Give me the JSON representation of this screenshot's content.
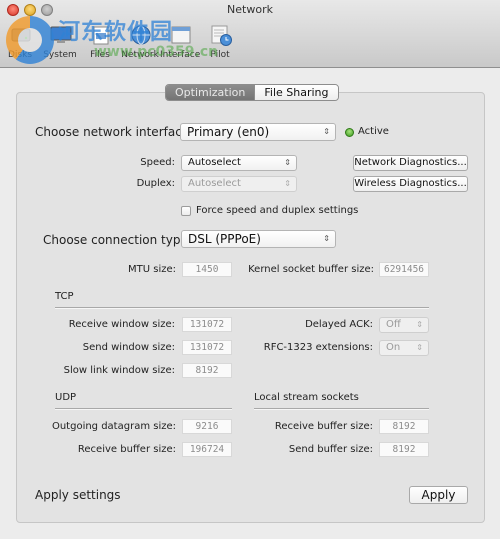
{
  "window": {
    "title": "Network"
  },
  "toolbar": {
    "items": [
      {
        "label": "Disks",
        "icon": "disk-icon"
      },
      {
        "label": "System",
        "icon": "system-icon"
      },
      {
        "label": "Files",
        "icon": "files-icon"
      },
      {
        "label": "Network",
        "icon": "network-globe-icon"
      },
      {
        "label": "Interface",
        "icon": "interface-icon"
      },
      {
        "label": "Pilot",
        "icon": "pilot-icon"
      }
    ]
  },
  "watermark": {
    "text": "河东软件园",
    "url": "www.pc0359.cn"
  },
  "tabs": [
    {
      "label": "Optimization",
      "active": true
    },
    {
      "label": "File Sharing",
      "active": false
    }
  ],
  "interface": {
    "label": "Choose network interface:",
    "value": "Primary (en0)",
    "status": "Active",
    "status_color": "#4caf2a"
  },
  "speed": {
    "label": "Speed:",
    "value": "Autoselect"
  },
  "duplex": {
    "label": "Duplex:",
    "value": "Autoselect"
  },
  "buttons": {
    "network_diagnostics": "Network Diagnostics...",
    "wireless_diagnostics": "Wireless Diagnostics...",
    "apply": "Apply"
  },
  "force_checkbox": {
    "label": "Force speed and duplex settings",
    "checked": false
  },
  "connection": {
    "label": "Choose connection type:",
    "value": "DSL (PPPoE)"
  },
  "mtu": {
    "label": "MTU size:",
    "value": "1450"
  },
  "kernel_buffer": {
    "label": "Kernel socket buffer size:",
    "value": "6291456"
  },
  "tcp": {
    "title": "TCP",
    "receive_window": {
      "label": "Receive window size:",
      "value": "131072"
    },
    "send_window": {
      "label": "Send window size:",
      "value": "131072"
    },
    "slow_link_window": {
      "label": "Slow link window size:",
      "value": "8192"
    },
    "delayed_ack": {
      "label": "Delayed ACK:",
      "value": "Off"
    },
    "rfc1323": {
      "label": "RFC-1323 extensions:",
      "value": "On"
    }
  },
  "udp": {
    "title": "UDP",
    "outgoing_datagram": {
      "label": "Outgoing datagram size:",
      "value": "9216"
    },
    "receive_buffer": {
      "label": "Receive buffer size:",
      "value": "196724"
    }
  },
  "local_stream": {
    "title": "Local stream sockets",
    "receive_buffer": {
      "label": "Receive buffer size:",
      "value": "8192"
    },
    "send_buffer": {
      "label": "Send buffer size:",
      "value": "8192"
    }
  },
  "apply_settings": {
    "label": "Apply settings"
  }
}
